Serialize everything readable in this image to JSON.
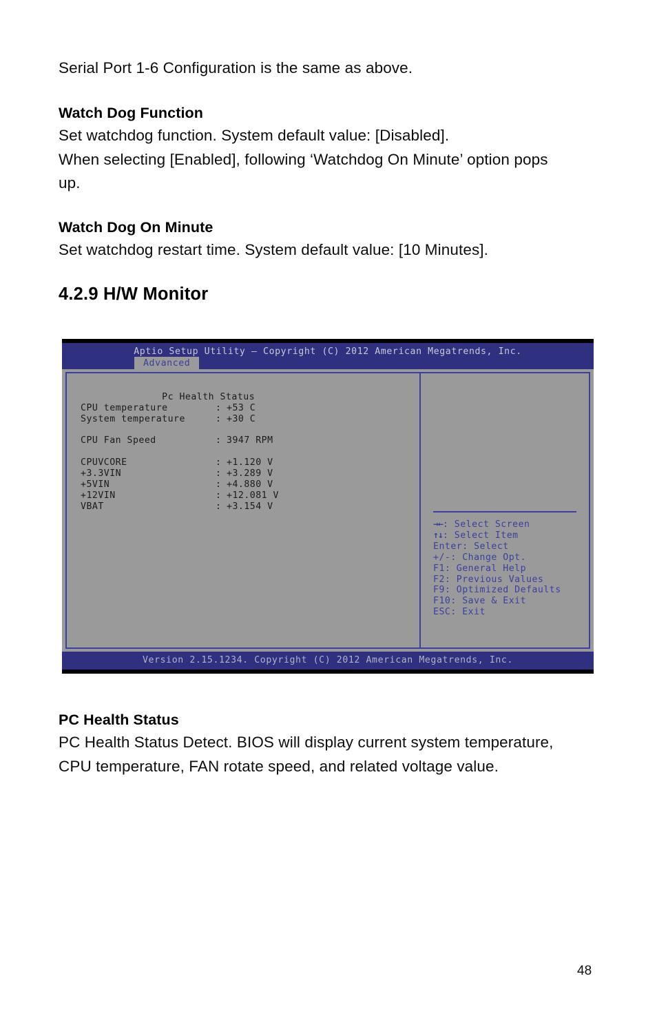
{
  "document": {
    "intro_line": "Serial Port 1-6 Configuration is the same as above.",
    "sections": [
      {
        "heading": "Watch Dog Function",
        "lines": [
          "Set watchdog function. System default value: [Disabled].",
          "When selecting [Enabled], following ‘Watchdog On Minute’ option pops",
          "up."
        ]
      },
      {
        "heading": "Watch Dog On Minute",
        "lines": [
          "Set watchdog restart time. System default value: [10 Minutes]."
        ]
      }
    ],
    "section_title": "4.2.9 H/W Monitor",
    "footer_sections": [
      {
        "heading": "PC Health Status",
        "lines": [
          "PC Health Status Detect. BIOS will display current system temperature,",
          "CPU temperature, FAN rotate speed, and related voltage value."
        ]
      }
    ],
    "page_number": "48"
  },
  "bios": {
    "title": "Aptio Setup Utility – Copyright (C) 2012 American Megatrends, Inc.",
    "tab": "Advanced",
    "section_header": "Pc Health Status",
    "items": [
      {
        "label": "CPU temperature",
        "sep": ":",
        "value": "+53 C"
      },
      {
        "label": "System temperature",
        "sep": ":",
        "value": "+30 C"
      },
      {
        "label": "",
        "sep": "",
        "value": ""
      },
      {
        "label": "CPU Fan Speed",
        "sep": ":",
        "value": "3947 RPM"
      },
      {
        "label": "",
        "sep": "",
        "value": ""
      },
      {
        "label": "CPUVCORE",
        "sep": ":",
        "value": "+1.120 V"
      },
      {
        "label": "+3.3VIN",
        "sep": ":",
        "value": "+3.289 V"
      },
      {
        "label": "+5VIN",
        "sep": ":",
        "value": "+4.880 V"
      },
      {
        "label": "+12VIN",
        "sep": ":",
        "value": "+12.081 V"
      },
      {
        "label": "VBAT",
        "sep": ":",
        "value": "+3.154 V"
      }
    ],
    "help": [
      {
        "glyph": "→←",
        "text": ": Select Screen"
      },
      {
        "glyph": "↑↓",
        "text": ": Select Item"
      },
      {
        "glyph": "",
        "text": "Enter: Select"
      },
      {
        "glyph": "",
        "text": "+/-: Change Opt."
      },
      {
        "glyph": "",
        "text": "F1: General Help"
      },
      {
        "glyph": "",
        "text": "F2: Previous Values"
      },
      {
        "glyph": "",
        "text": "F9: Optimized Defaults"
      },
      {
        "glyph": "",
        "text": "F10: Save & Exit"
      },
      {
        "glyph": "",
        "text": "ESC: Exit"
      }
    ],
    "footer": "Version 2.15.1234. Copyright (C) 2012 American Megatrends, Inc.",
    "colors": {
      "header_bg": "#2f3180",
      "panel_bg": "#9a9a9a",
      "border": "#3b3fa0",
      "help_text": "#3b3fa0",
      "body_text": "#1b1b1b",
      "title_text": "#c9c9d6"
    }
  }
}
